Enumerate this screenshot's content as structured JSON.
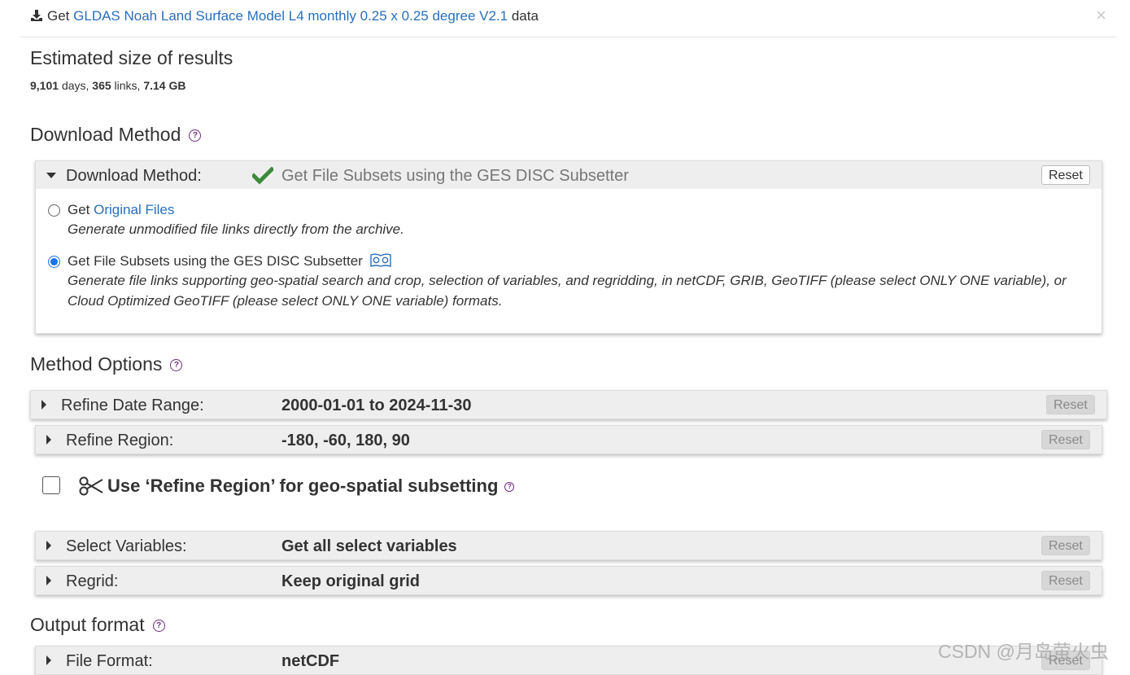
{
  "header": {
    "prefix": "Get",
    "dataset_link": "GLDAS Noah Land Surface Model L4 monthly 0.25 x 0.25 degree V2.1",
    "suffix": "data",
    "close_label": "×"
  },
  "estimate": {
    "heading": "Estimated size of results",
    "days": "9,101",
    "days_label": "days,",
    "links": "365",
    "links_label": "links,",
    "size": "7.14 GB"
  },
  "download_method": {
    "heading": "Download Method",
    "panel_label": "Download Method:",
    "selected_value": "Get File Subsets using the GES DISC Subsetter",
    "reset_label": "Reset",
    "options": [
      {
        "prefix": "Get",
        "link": "Original Files",
        "description": "Generate unmodified file links directly from the archive.",
        "selected": false
      },
      {
        "label": "Get File Subsets using the GES DISC Subsetter",
        "description": "Generate file links supporting geo-spatial search and crop, selection of variables, and regridding, in netCDF, GRIB, GeoTIFF (please select ONLY ONE variable), or Cloud Optimized GeoTIFF (please select ONLY ONE variable) formats.",
        "selected": true
      }
    ]
  },
  "method_options": {
    "heading": "Method Options",
    "date_range": {
      "label": "Refine Date Range:",
      "value": "2000-01-01 to 2024-11-30",
      "reset_label": "Reset"
    },
    "region": {
      "label": "Refine Region:",
      "value": "-180, -60, 180, 90",
      "reset_label": "Reset"
    },
    "spatial_subset_label": "Use ‘Refine Region’ for geo-spatial subsetting",
    "spatial_subset_checked": false,
    "variables": {
      "label": "Select Variables:",
      "value": "Get all select variables",
      "reset_label": "Reset"
    },
    "regrid": {
      "label": "Regrid:",
      "value": "Keep original grid",
      "reset_label": "Reset"
    }
  },
  "output_format": {
    "heading": "Output format",
    "file_format": {
      "label": "File Format:",
      "value": "netCDF",
      "reset_label": "Reset"
    }
  },
  "help_symbol": "?",
  "watermark": "CSDN @月岛萤火虫",
  "colors": {
    "link": "#2a6ebb",
    "check": "#3c8a3c",
    "help": "#6f2c82",
    "radio": "#1a73e8"
  }
}
